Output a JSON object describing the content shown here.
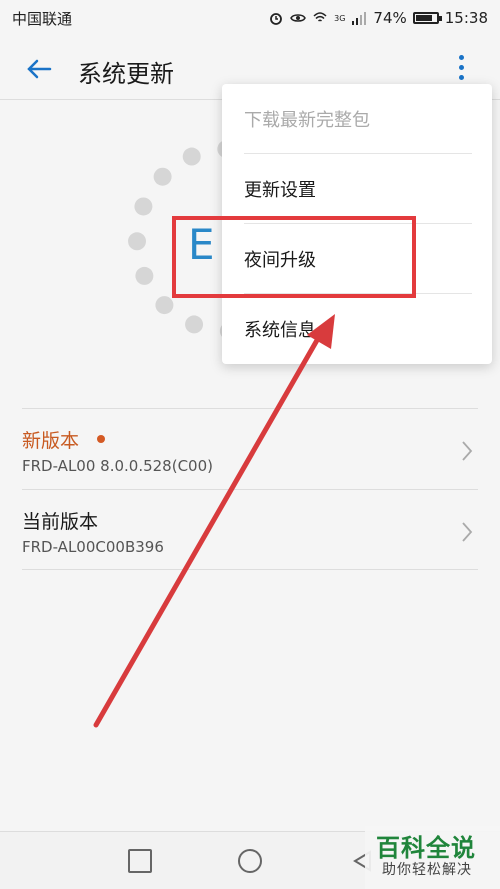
{
  "status": {
    "carrier": "中国联通",
    "network": "3G",
    "battery": "74%",
    "time": "15:38"
  },
  "app_bar": {
    "title": "系统更新",
    "back_icon": "arrow-left-icon",
    "more_icon": "more-vert-icon"
  },
  "background": {
    "dial_letter": "E"
  },
  "list": {
    "new_version_label": "新版本",
    "new_version_value": "FRD-AL00 8.0.0.528(C00)",
    "current_version_label": "当前版本",
    "current_version_value": "FRD-AL00C00B396"
  },
  "menu": {
    "items": [
      {
        "label": "下载最新完整包",
        "enabled": false
      },
      {
        "label": "更新设置",
        "enabled": true
      },
      {
        "label": "夜间升级",
        "enabled": true
      },
      {
        "label": "系统信息",
        "enabled": true
      }
    ]
  },
  "watermark": {
    "main": "百科全说",
    "sub": "助你轻松解决"
  },
  "colors": {
    "accent": "#1a73c7",
    "new_version": "#c85a21",
    "highlight": "#e33a3d",
    "watermark": "#20853b"
  }
}
